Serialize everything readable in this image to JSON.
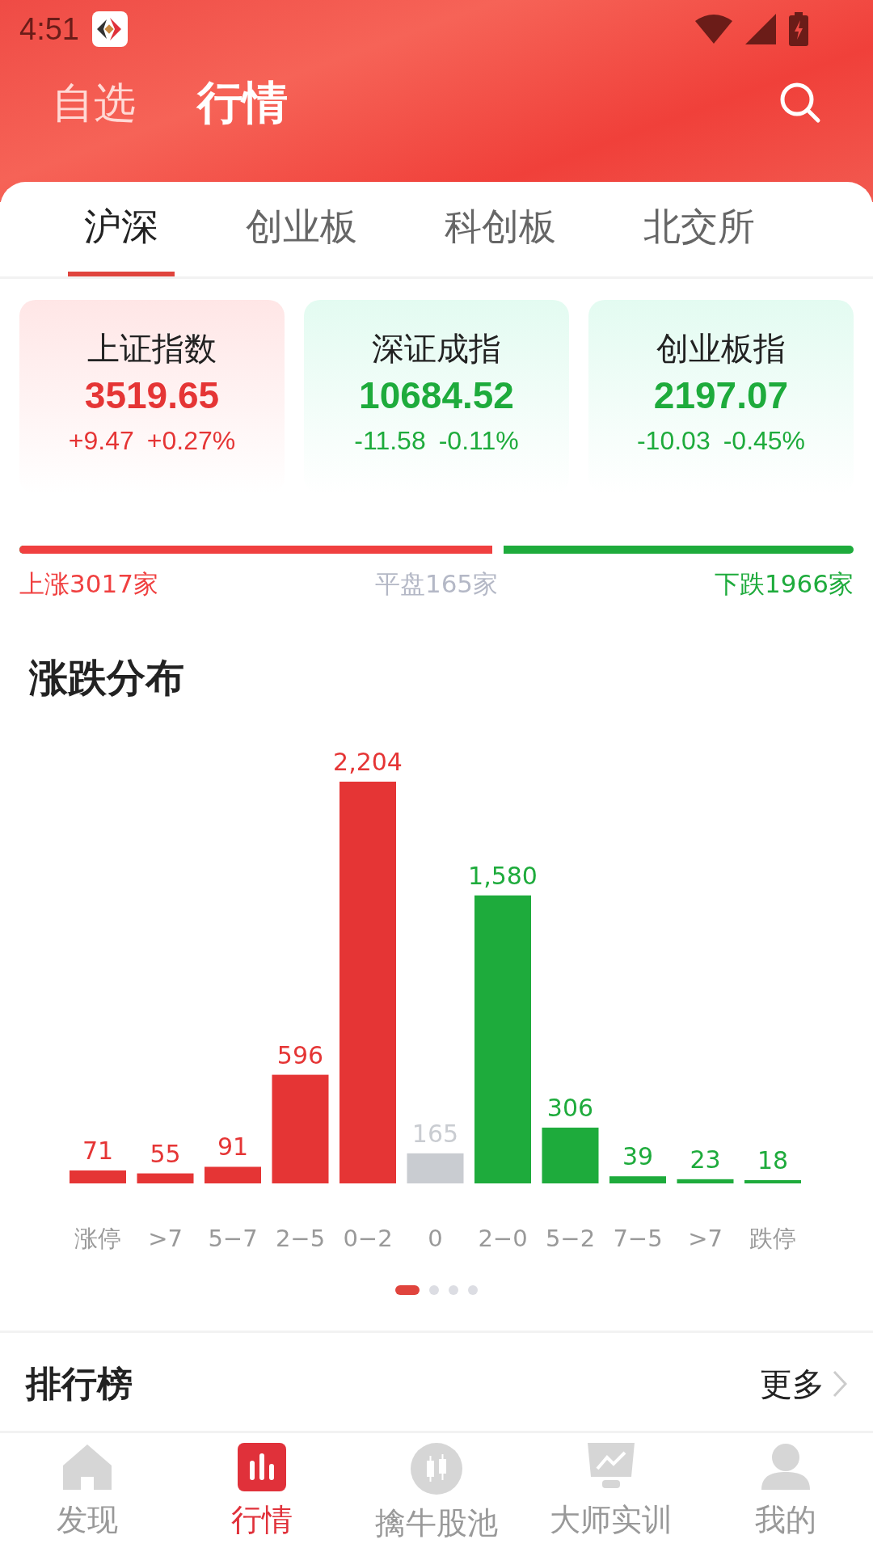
{
  "status_bar": {
    "time": "4:51"
  },
  "header": {
    "tabs": [
      {
        "label": "自选",
        "selected": false
      },
      {
        "label": "行情",
        "selected": true
      }
    ]
  },
  "market_tabs": [
    {
      "label": "沪深",
      "selected": true
    },
    {
      "label": "创业板",
      "selected": false
    },
    {
      "label": "科创板",
      "selected": false
    },
    {
      "label": "北交所",
      "selected": false
    }
  ],
  "indices": [
    {
      "name": "上证指数",
      "value": "3519.65",
      "change": "+9.47",
      "percent": "+0.27%",
      "kind": "up"
    },
    {
      "name": "深证成指",
      "value": "10684.52",
      "change": "-11.58",
      "percent": "-0.11%",
      "kind": "down"
    },
    {
      "name": "创业板指",
      "value": "2197.07",
      "change": "-10.03",
      "percent": "-0.45%",
      "kind": "down"
    }
  ],
  "breadth": {
    "level": 0.58,
    "up": "上涨3017家",
    "flat": "平盘165家",
    "down": "下跌1966家"
  },
  "distribution": {
    "title": "涨跌分布",
    "chart_data": {
      "type": "bar",
      "categories": [
        "涨停",
        ">7",
        "5−7",
        "2−5",
        "0−2",
        "0",
        "2−0",
        "5−2",
        "7−5",
        ">7",
        "跌停"
      ],
      "data_labels": true,
      "series": [
        {
          "color": "#e53535",
          "values": [
            71,
            55,
            91,
            596,
            2204,
            null,
            null,
            null,
            null,
            null,
            null
          ],
          "value_labels": [
            "71",
            "55",
            "91",
            "596",
            "2,204",
            null,
            null,
            null,
            null,
            null,
            null
          ]
        },
        {
          "color": "#c9ccd1",
          "values": [
            null,
            null,
            null,
            null,
            null,
            165,
            null,
            null,
            null,
            null,
            null
          ],
          "value_labels": [
            null,
            null,
            null,
            null,
            null,
            "165",
            null,
            null,
            null,
            null,
            null
          ]
        },
        {
          "color": "#1eab3c",
          "values": [
            null,
            null,
            null,
            null,
            null,
            null,
            1580,
            306,
            39,
            23,
            18
          ],
          "value_labels": [
            null,
            null,
            null,
            null,
            null,
            null,
            "1,580",
            "306",
            "39",
            "23",
            "18"
          ]
        }
      ]
    },
    "pager": [
      {
        "selected": true
      },
      {
        "selected": false
      },
      {
        "selected": false
      },
      {
        "selected": false
      }
    ]
  },
  "ranking": {
    "title": "排行榜",
    "more": "更多"
  },
  "bottom_nav": [
    {
      "label": "发现",
      "selected": false
    },
    {
      "label": "行情",
      "selected": true
    },
    {
      "label": "擒牛股池",
      "selected": false
    },
    {
      "label": "大师实训",
      "selected": false
    },
    {
      "label": "我的",
      "selected": false
    }
  ]
}
